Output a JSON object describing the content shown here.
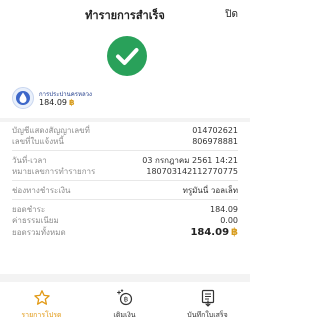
{
  "header": {
    "title": "ทำรายการสำเร็จ",
    "close_label": "ปิด"
  },
  "biller": {
    "name": "การประปานครหลวง",
    "amount": "184.09",
    "currency_symbol": "฿"
  },
  "details": {
    "account_label": "บัญชีแสดงสัญญาเลขที่",
    "account_value": "014702621",
    "invoice_label": "เลขที่ใบแจ้งหนี้",
    "invoice_value": "806978881",
    "datetime_label": "วันที่-เวลา",
    "datetime_value": "03 กรกฎาคม 2561 14:21",
    "txn_label": "หมายเลขการทำรายการ",
    "txn_value": "180703142112770775",
    "channel_label": "ช่องทางชำระเงิน",
    "channel_value": "ทรูมันนี่ วอลเล็ท",
    "payment_label": "ยอดชำระ",
    "payment_value": "184.09",
    "fee_label": "ค่าธรรมเนียม",
    "fee_value": "0.00",
    "total_label": "ยอดรวมทั้งหมด",
    "total_value": "184.09"
  },
  "tabs": [
    {
      "label": "รายการโปรด",
      "icon": "star-icon"
    },
    {
      "label": "เติมเงิน",
      "icon": "topup-icon"
    },
    {
      "label": "บันทึกใบเสร็จ",
      "icon": "save-receipt-icon"
    }
  ],
  "colors": {
    "accent": "#e29a16",
    "success": "#29a15a",
    "baht": "#d79b1b"
  }
}
